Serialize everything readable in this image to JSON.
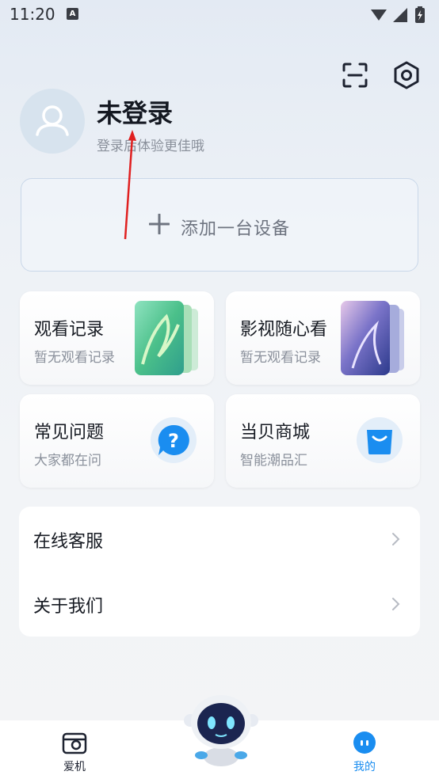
{
  "status_bar": {
    "time": "11:20",
    "notif_letter": "A"
  },
  "profile": {
    "name": "未登录",
    "subtitle": "登录后体验更佳哦"
  },
  "add_device": {
    "label": "添加一台设备"
  },
  "cards": [
    {
      "title": "观看记录",
      "subtitle": "暂无观看记录"
    },
    {
      "title": "影视随心看",
      "subtitle": "暂无观看记录"
    },
    {
      "title": "常见问题",
      "subtitle": "大家都在问"
    },
    {
      "title": "当贝商城",
      "subtitle": "智能潮品汇"
    }
  ],
  "list": [
    {
      "label": "在线客服"
    },
    {
      "label": "关于我们"
    }
  ],
  "tabs": [
    {
      "label": "爱机",
      "active": false
    },
    {
      "label": "我的",
      "active": true
    }
  ],
  "colors": {
    "accent": "#1a8df0",
    "arrow": "#e02020",
    "text_primary": "#161a22",
    "text_secondary": "#8a909b"
  }
}
